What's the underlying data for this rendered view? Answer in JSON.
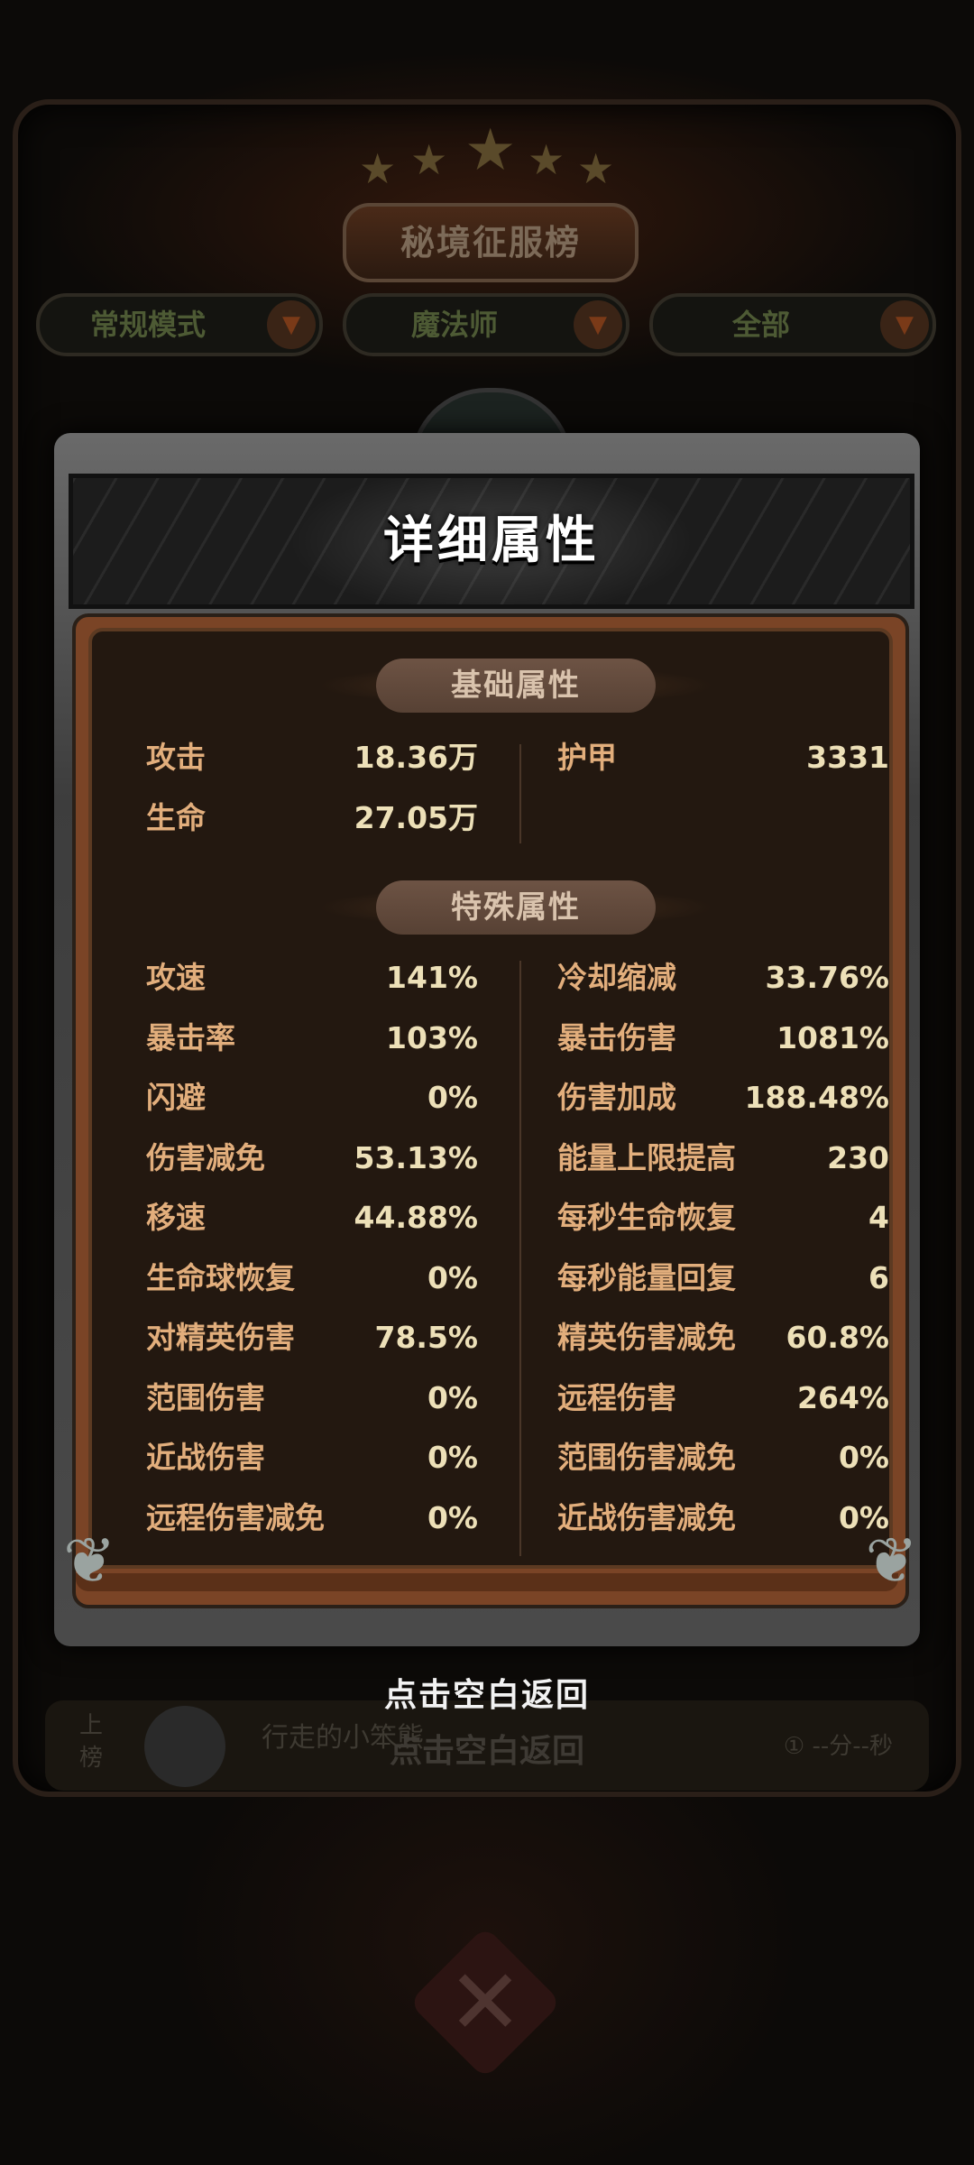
{
  "background": {
    "title": "秘境征服榜",
    "filters": [
      {
        "label": "常规模式"
      },
      {
        "label": "魔法师"
      },
      {
        "label": "全部"
      }
    ],
    "my_row": {
      "rank_label": "上榜",
      "name": "行走的小笨熊",
      "time": "① --分--秒"
    },
    "ghost_return": "点击空白返回"
  },
  "modal": {
    "title": "详细属性",
    "basic": {
      "title": "基础属性",
      "left": [
        {
          "name": "攻击",
          "value": "18.36万"
        },
        {
          "name": "生命",
          "value": "27.05万"
        }
      ],
      "right": [
        {
          "name": "护甲",
          "value": "3331"
        }
      ]
    },
    "special": {
      "title": "特殊属性",
      "left": [
        {
          "name": "攻速",
          "value": "141%"
        },
        {
          "name": "暴击率",
          "value": "103%"
        },
        {
          "name": "闪避",
          "value": "0%"
        },
        {
          "name": "伤害减免",
          "value": "53.13%"
        },
        {
          "name": "移速",
          "value": "44.88%"
        },
        {
          "name": "生命球恢复",
          "value": "0%"
        },
        {
          "name": "对精英伤害",
          "value": "78.5%"
        },
        {
          "name": "范围伤害",
          "value": "0%"
        },
        {
          "name": "近战伤害",
          "value": "0%"
        },
        {
          "name": "远程伤害减免",
          "value": "0%"
        }
      ],
      "right": [
        {
          "name": "冷却缩减",
          "value": "33.76%"
        },
        {
          "name": "暴击伤害",
          "value": "1081%"
        },
        {
          "name": "伤害加成",
          "value": "188.48%"
        },
        {
          "name": "能量上限提高",
          "value": "230"
        },
        {
          "name": "每秒生命恢复",
          "value": "4"
        },
        {
          "name": "每秒能量回复",
          "value": "6"
        },
        {
          "name": "精英伤害减免",
          "value": "60.8%"
        },
        {
          "name": "远程伤害",
          "value": "264%"
        },
        {
          "name": "范围伤害减免",
          "value": "0%"
        },
        {
          "name": "近战伤害减免",
          "value": "0%"
        }
      ]
    }
  },
  "return_hint": "点击空白返回",
  "colors": {
    "stat_name": "#e2ae7c",
    "stat_value": "#ede0b8",
    "panel": "#231810"
  }
}
